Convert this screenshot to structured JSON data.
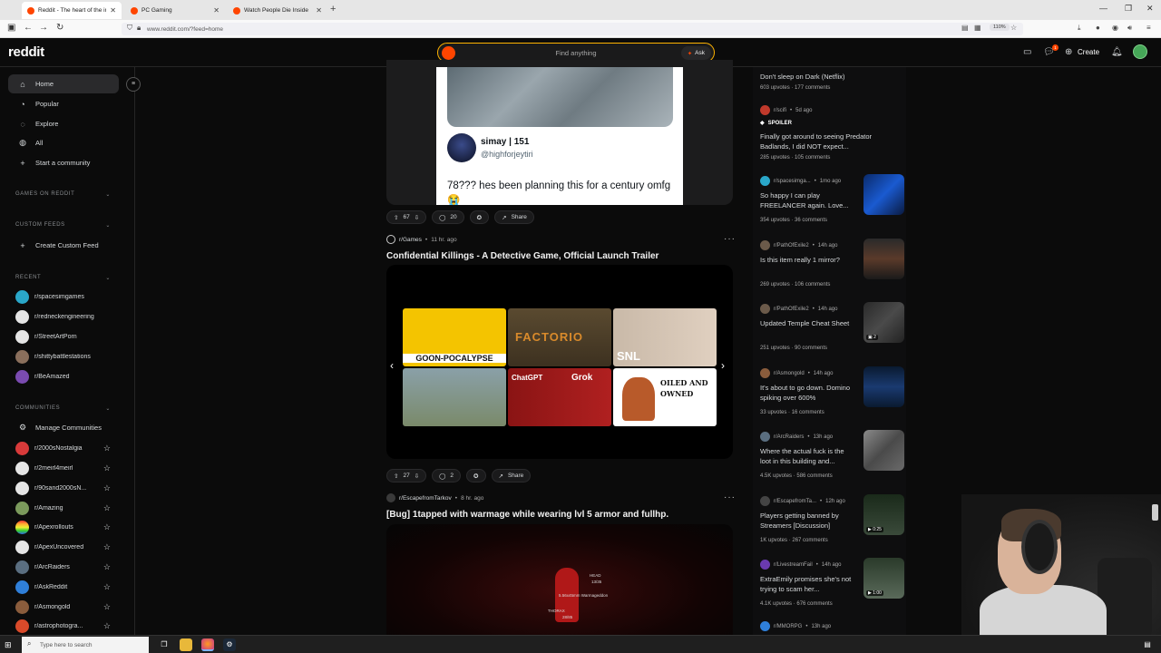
{
  "browser": {
    "tabs": [
      {
        "label": "Reddit - The heart of the intern"
      },
      {
        "label": "PC Gaming"
      },
      {
        "label": "Watch People Die Inside"
      }
    ],
    "url": "www.reddit.com/?feed=home",
    "zoom": "110%"
  },
  "header": {
    "logo": "reddit",
    "search_placeholder": "Find anything",
    "ask_label": "Ask",
    "create_label": "Create",
    "notification_count": "1"
  },
  "sidebar": {
    "nav": [
      {
        "label": "Home",
        "icon": "home-icon"
      },
      {
        "label": "Popular",
        "icon": "popular-icon"
      },
      {
        "label": "Explore",
        "icon": "explore-icon"
      },
      {
        "label": "All",
        "icon": "all-icon"
      },
      {
        "label": "Start a community",
        "icon": "plus-icon"
      }
    ],
    "games_section": "GAMES ON REDDIT",
    "custom_feeds_section": "CUSTOM FEEDS",
    "create_custom_feed": "Create Custom Feed",
    "recent_section": "RECENT",
    "recent": [
      {
        "name": "r/spacesimgames",
        "color": "#2aa7c9"
      },
      {
        "name": "r/redneckengineering",
        "color": "#e5e5e5"
      },
      {
        "name": "r/StreetArtPorn",
        "color": "#e5e5e5"
      },
      {
        "name": "r/shittybattlestations",
        "color": "#8a6f5c"
      },
      {
        "name": "r/BeAmazed",
        "color": "#7a4bb0"
      }
    ],
    "communities_section": "COMMUNITIES",
    "manage_communities": "Manage Communities",
    "communities": [
      {
        "name": "r/2000sNostalgia",
        "color": "#d83a3a"
      },
      {
        "name": "r/2meirl4meirl",
        "color": "#e5e5e5"
      },
      {
        "name": "r/90sand2000sN...",
        "color": "#e5e5e5"
      },
      {
        "name": "r/Amazing",
        "color": "#7b9a5c"
      },
      {
        "name": "r/Apexrollouts",
        "color": "#e8a33a"
      },
      {
        "name": "r/ApexUncovered",
        "color": "#e5e5e5"
      },
      {
        "name": "r/ArcRaiders",
        "color": "#5a6e80"
      },
      {
        "name": "r/AskReddit",
        "color": "#2f7fd9"
      },
      {
        "name": "r/Asmongold",
        "color": "#8a5c3c"
      },
      {
        "name": "r/astrophotogra...",
        "color": "#d94a2a"
      }
    ]
  },
  "feed": {
    "post1": {
      "tweet_name": "simay | 151",
      "tweet_handle": "@highforjeytiri",
      "tweet_text": "78??? hes been planning this for a century omfg 😭",
      "votes": "67",
      "comments": "20",
      "share": "Share"
    },
    "post2": {
      "subreddit": "r/Games",
      "time": "11 hr. ago",
      "title": "Confidential Killings - A Detective Game, Official Launch Trailer",
      "tiles": {
        "goon": "GOON-POCALYPSE",
        "factorio": "FACTORIO",
        "snl": "SNL",
        "chatgpt": "ChatGPT",
        "grok": "Grok",
        "oiled": "OILED AND OWNED"
      },
      "votes": "27",
      "comments": "2",
      "share": "Share"
    },
    "post3": {
      "subreddit": "r/EscapefromTarkov",
      "time": "8 hr. ago",
      "title": "[Bug] 1tapped with warmage while wearing lvl 5 armor and fullhp.",
      "hud": {
        "head": "HEAD",
        "head_hp": "13/35",
        "thorax": "THORAX",
        "thorax_hp": "28/85",
        "ammo": "5.56x45mm Warmageddon"
      }
    }
  },
  "right": {
    "items": [
      {
        "subreddit": "",
        "time": "",
        "title": "Don't sleep on Dark (Netflix)",
        "upvotes": "603 upvotes",
        "comments": "177 comments",
        "color": "#555"
      },
      {
        "subreddit": "r/scifi",
        "time": "5d ago",
        "spoiler": "SPOILER",
        "title": "Finally got around to seeing Predator Badlands, I did NOT expect...",
        "upvotes": "285 upvotes",
        "comments": "105 comments",
        "color": "#c0392b"
      },
      {
        "subreddit": "r/spacesimga...",
        "time": "1mo ago",
        "title": "So happy I can play FREELANCER again. Love...",
        "upvotes": "354 upvotes",
        "comments": "36 comments",
        "color": "#2aa7c9"
      },
      {
        "subreddit": "r/PathOfExile2",
        "time": "14h ago",
        "title": "Is this item really 1 mirror?",
        "upvotes": "269 upvotes",
        "comments": "106 comments",
        "color": "#6b5a4a"
      },
      {
        "subreddit": "r/PathOfExile2",
        "time": "14h ago",
        "title": "Updated Temple Cheat Sheet",
        "upvotes": "251 upvotes",
        "comments": "90 comments",
        "color": "#6b5a4a",
        "gallery": "2"
      },
      {
        "subreddit": "r/Asmongold",
        "time": "14h ago",
        "title": "It's about to go down. Domino spiking over 600%",
        "upvotes": "33 upvotes",
        "comments": "16 comments",
        "color": "#8a5c3c"
      },
      {
        "subreddit": "r/ArcRaiders",
        "time": "13h ago",
        "title": "Where the actual fuck is the loot in this building and...",
        "upvotes": "4.5K upvotes",
        "comments": "586 comments",
        "color": "#5a6e80"
      },
      {
        "subreddit": "r/EscapefromTa...",
        "time": "12h ago",
        "title": "Players getting banned by Streamers [Discussion]",
        "upvotes": "1K upvotes",
        "comments": "267 comments",
        "color": "#444",
        "duration": "0:25"
      },
      {
        "subreddit": "r/LivestreamFail",
        "time": "14h ago",
        "title": "ExtraEmily promises she's not trying to scam her...",
        "upvotes": "4.1K upvotes",
        "comments": "676 comments",
        "color": "#6a3ab0",
        "duration": "1:00"
      },
      {
        "subreddit": "r/MMORPG",
        "time": "13h ago",
        "title": "",
        "upvotes": "",
        "comments": "",
        "color": "#2f7fd9"
      }
    ]
  },
  "taskbar": {
    "search_placeholder": "Type here to search"
  }
}
